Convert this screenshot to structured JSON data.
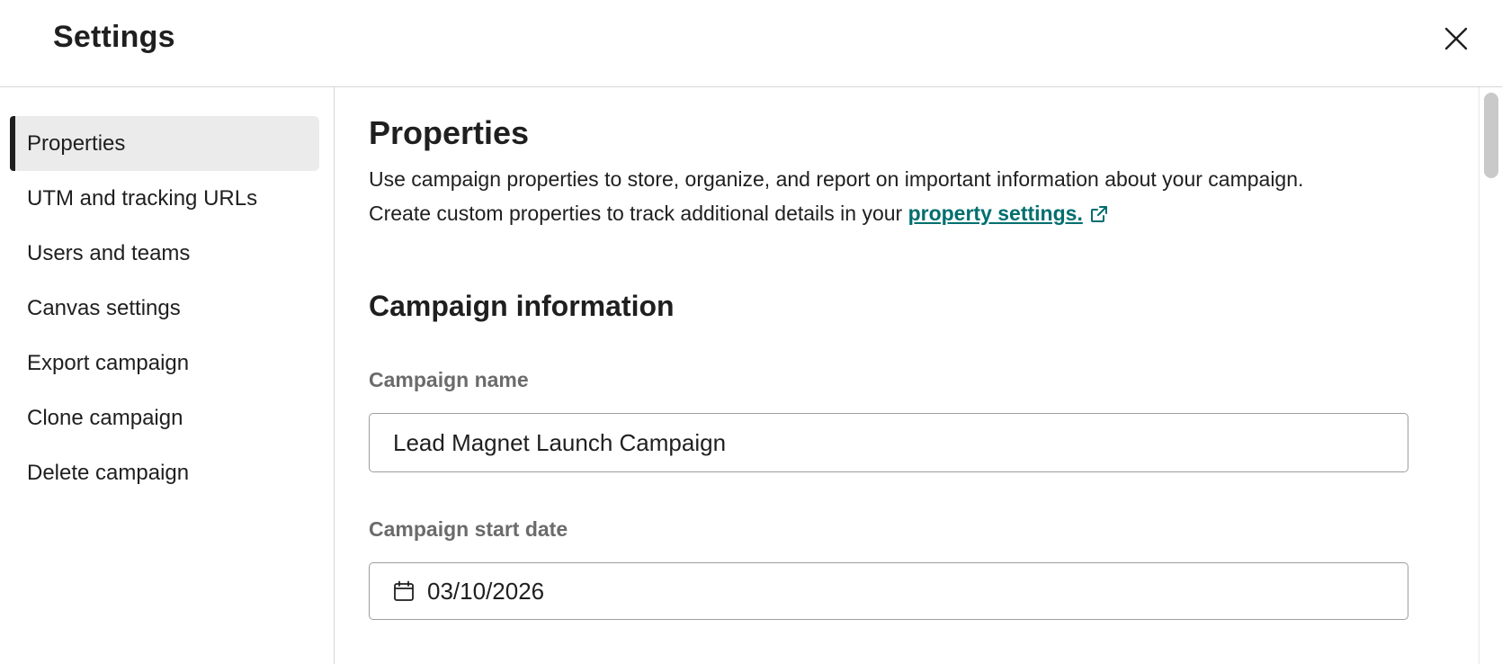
{
  "header": {
    "title": "Settings",
    "close_icon": "close-icon"
  },
  "sidebar": {
    "items": [
      {
        "label": "Properties",
        "active": true
      },
      {
        "label": "UTM and tracking URLs",
        "active": false
      },
      {
        "label": "Users and teams",
        "active": false
      },
      {
        "label": "Canvas settings",
        "active": false
      },
      {
        "label": "Export campaign",
        "active": false
      },
      {
        "label": "Clone campaign",
        "active": false
      },
      {
        "label": "Delete campaign",
        "active": false
      }
    ]
  },
  "main": {
    "title": "Properties",
    "description_line1": "Use campaign properties to store, organize, and report on important information about your campaign.",
    "description_line2": "Create custom properties to track additional details in your ",
    "link_text": "property settings.",
    "link_icon": "external-link-icon",
    "subsection_title": "Campaign information",
    "fields": {
      "name": {
        "label": "Campaign name",
        "value": "Lead Magnet Launch Campaign"
      },
      "start_date": {
        "label": "Campaign start date",
        "value": "03/10/2026",
        "icon": "calendar-icon"
      }
    }
  },
  "colors": {
    "link": "#006e6e",
    "active_nav_bg": "#ebebeb",
    "label": "#6b6b6b",
    "border": "#d6d6d6"
  }
}
